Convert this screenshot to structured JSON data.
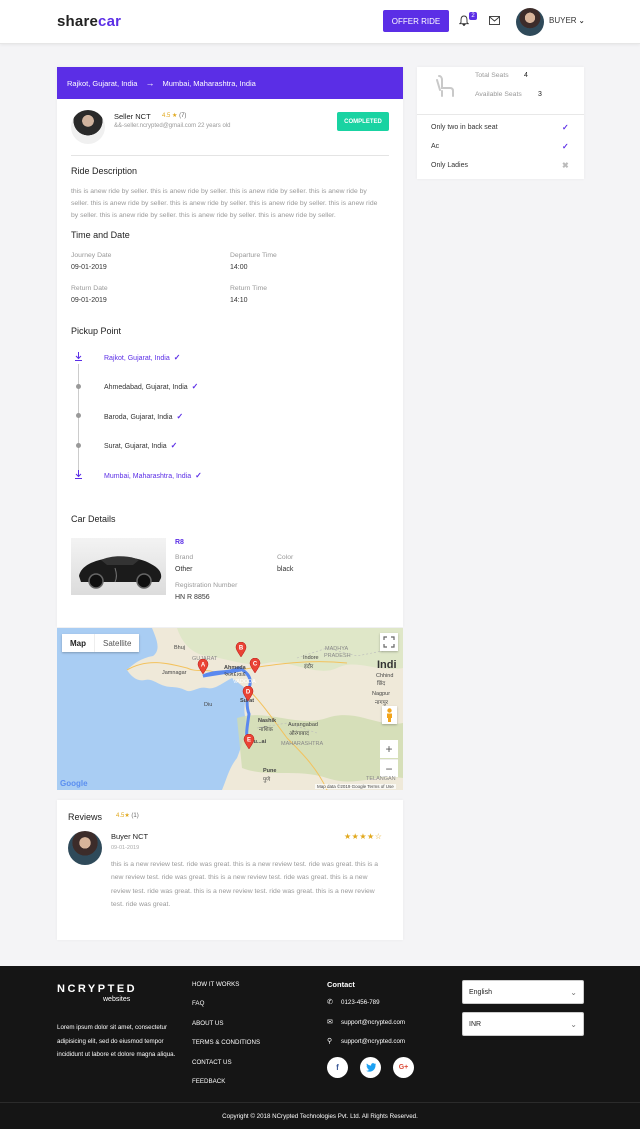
{
  "header": {
    "logo_part1": "share",
    "logo_part2": "car",
    "offer_ride_label": "OFFER RIDE",
    "notification_count": "2",
    "user_label": "BUYER"
  },
  "ride": {
    "from": "Rajkot, Gujarat, India",
    "to": "Mumbai, Maharashtra, India",
    "seller_name": "Seller NCT",
    "seller_rating": "4.5",
    "seller_rating_count": "(7)",
    "seller_meta": "&&-seller.ncrypted@gmail.com 22 years old",
    "status": "COMPLETED"
  },
  "description": {
    "title": "Ride Description",
    "text": "this is anew ride by seller. this is anew ride by seller. this is anew ride by seller. this is anew ride by seller. this is anew ride by seller. this is anew ride by seller. this is anew ride by seller. this is anew ride by seller. this is anew ride by seller. this is anew ride by seller. this is anew ride by seller."
  },
  "time_date": {
    "title": "Time and Date",
    "journey_date_label": "Journey Date",
    "journey_date": "09-01-2019",
    "departure_time_label": "Departure Time",
    "departure_time": "14:00",
    "return_date_label": "Return Date",
    "return_date": "09-01-2019",
    "return_time_label": "Return Time",
    "return_time": "14:10"
  },
  "pickup": {
    "title": "Pickup Point",
    "points": [
      "Rajkot, Gujarat, India",
      "Ahmedabad, Gujarat, India",
      "Baroda, Gujarat, India",
      "Surat, Gujarat, India",
      "Mumbai, Maharashtra, India"
    ]
  },
  "car": {
    "title": "Car Details",
    "model": "R8",
    "brand_label": "Brand",
    "brand": "Other",
    "color_label": "Color",
    "color": "black",
    "reg_label": "Registration Number",
    "reg": "HN R 8856"
  },
  "seats": {
    "total_label": "Total Seats",
    "total": "4",
    "available_label": "Available Seats",
    "available": "3"
  },
  "features": [
    {
      "label": "Only two in back seat",
      "enabled": true
    },
    {
      "label": "Ac",
      "enabled": true
    },
    {
      "label": "Only Ladies",
      "enabled": false
    }
  ],
  "map": {
    "tab_map": "Map",
    "tab_satellite": "Satellite",
    "markers": [
      "A",
      "B",
      "C",
      "D",
      "E"
    ],
    "labels": {
      "bhuj": "Bhuj",
      "gujarat": "GUJARAT",
      "jamnagar": "Jamnagar",
      "ahmedabad": "Ahmeda",
      "ahmedabad_local": "અમદાવાદ",
      "vadodara": "VADODA",
      "surat": "Surat",
      "madhya": "MADHYA",
      "pradesh": "PRADESH",
      "indore": "Indore",
      "indore_local": "इंदौर",
      "india": "Indi",
      "chhind": "Chhind",
      "chhind_local": "छिंद",
      "nagpur": "Nagpur",
      "nagpur_local": "नागपुर",
      "nashik": "Nashik",
      "nashik_local": "नाशिक",
      "aurangabad": "Aurangabad",
      "aurangabad_local": "औरंगाबाद",
      "maharashtra": "MAHARASHTRA",
      "mumbai": "Mu...ai",
      "pune": "Pune",
      "pune_local": "पुणे",
      "telangana": "TELANGAN",
      "diu": "Diu"
    },
    "google": "Google",
    "attribution": "Map data ©2019 Google    Terms of Use"
  },
  "reviews": {
    "title": "Reviews",
    "rating": "4.5",
    "count": "(1)",
    "items": [
      {
        "name": "Buyer NCT",
        "date": "09-01-2019",
        "stars": "★★★★☆",
        "text": "this is a new review test. ride was great. this is a new review test. ride was great. this is a new review test. ride was great. this is a new review test. ride was great. this is a new review test. ride was great. this is a new review test. ride was great. this is a new review test. ride was great."
      }
    ]
  },
  "footer": {
    "logo": "NCRYPTED",
    "logo_sub": "websites",
    "about": "Lorem ipsum dolor sit amet, consectetur adipisicing elit, sed do eiusmod tempor incididunt ut labore et dolore magna aliqua.",
    "links": [
      "HOW IT WORKS",
      "FAQ",
      "ABOUT US",
      "TERMS & CONDITIONS",
      "CONTACT US",
      "FEEDBACK"
    ],
    "contact_title": "Contact",
    "phone": "0123-456-789",
    "email1": "support@ncrypted.com",
    "email2": "support@ncrypted.com",
    "language": "English",
    "currency": "INR",
    "copyright": "Copyright © 2018 NCrypted Technologies Pvt. Ltd. All Rights Reserved."
  }
}
